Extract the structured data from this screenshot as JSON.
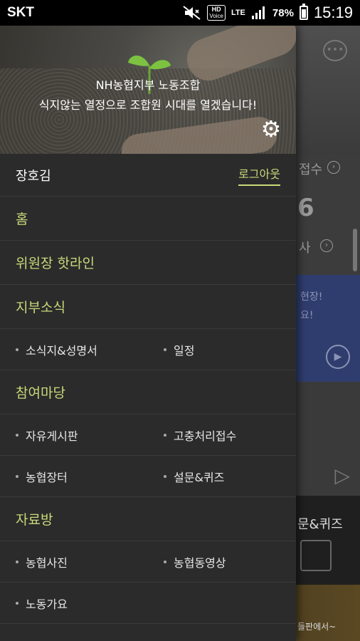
{
  "statusbar": {
    "carrier": "SKT",
    "hd_label": "HD",
    "voice_label": "Voice",
    "network": "LTE",
    "battery_percent": "78%",
    "battery_level": 0.78,
    "time": "15:19"
  },
  "background": {
    "text_jeopsu": "접수",
    "big_number": "6",
    "text_sa": "사",
    "blue_text_line1": "현장!",
    "blue_text_line2": "요!",
    "text_quiz": "문&퀴즈",
    "photo_text": "들판에서~"
  },
  "drawer": {
    "header": {
      "title": "NH농협지부 노동조합",
      "slogan": "식지않는 열정으로 조합원 시대를 열겠습니다!"
    },
    "user": {
      "name": "장호김",
      "logout_label": "로그아웃"
    },
    "menu": {
      "home": "홈",
      "hotline": "위원장 핫라인",
      "news": "지부소식",
      "news_items": [
        "소식지&성명서",
        "일정"
      ],
      "participation": "참여마당",
      "participation_items": [
        "자유게시판",
        "고충처리접수",
        "농협장터",
        "설문&퀴즈"
      ],
      "archive": "자료방",
      "archive_items": [
        "농협사진",
        "농협동영상",
        "노동가요"
      ]
    }
  },
  "colors": {
    "accent": "#c9d97a",
    "drawer_bg": "#2b2b2b",
    "statusbar_bg": "#000000"
  },
  "icons": [
    "mute-icon",
    "signal-icon",
    "battery-icon",
    "settings-gear-icon",
    "chat-icon",
    "play-icon",
    "send-icon"
  ]
}
